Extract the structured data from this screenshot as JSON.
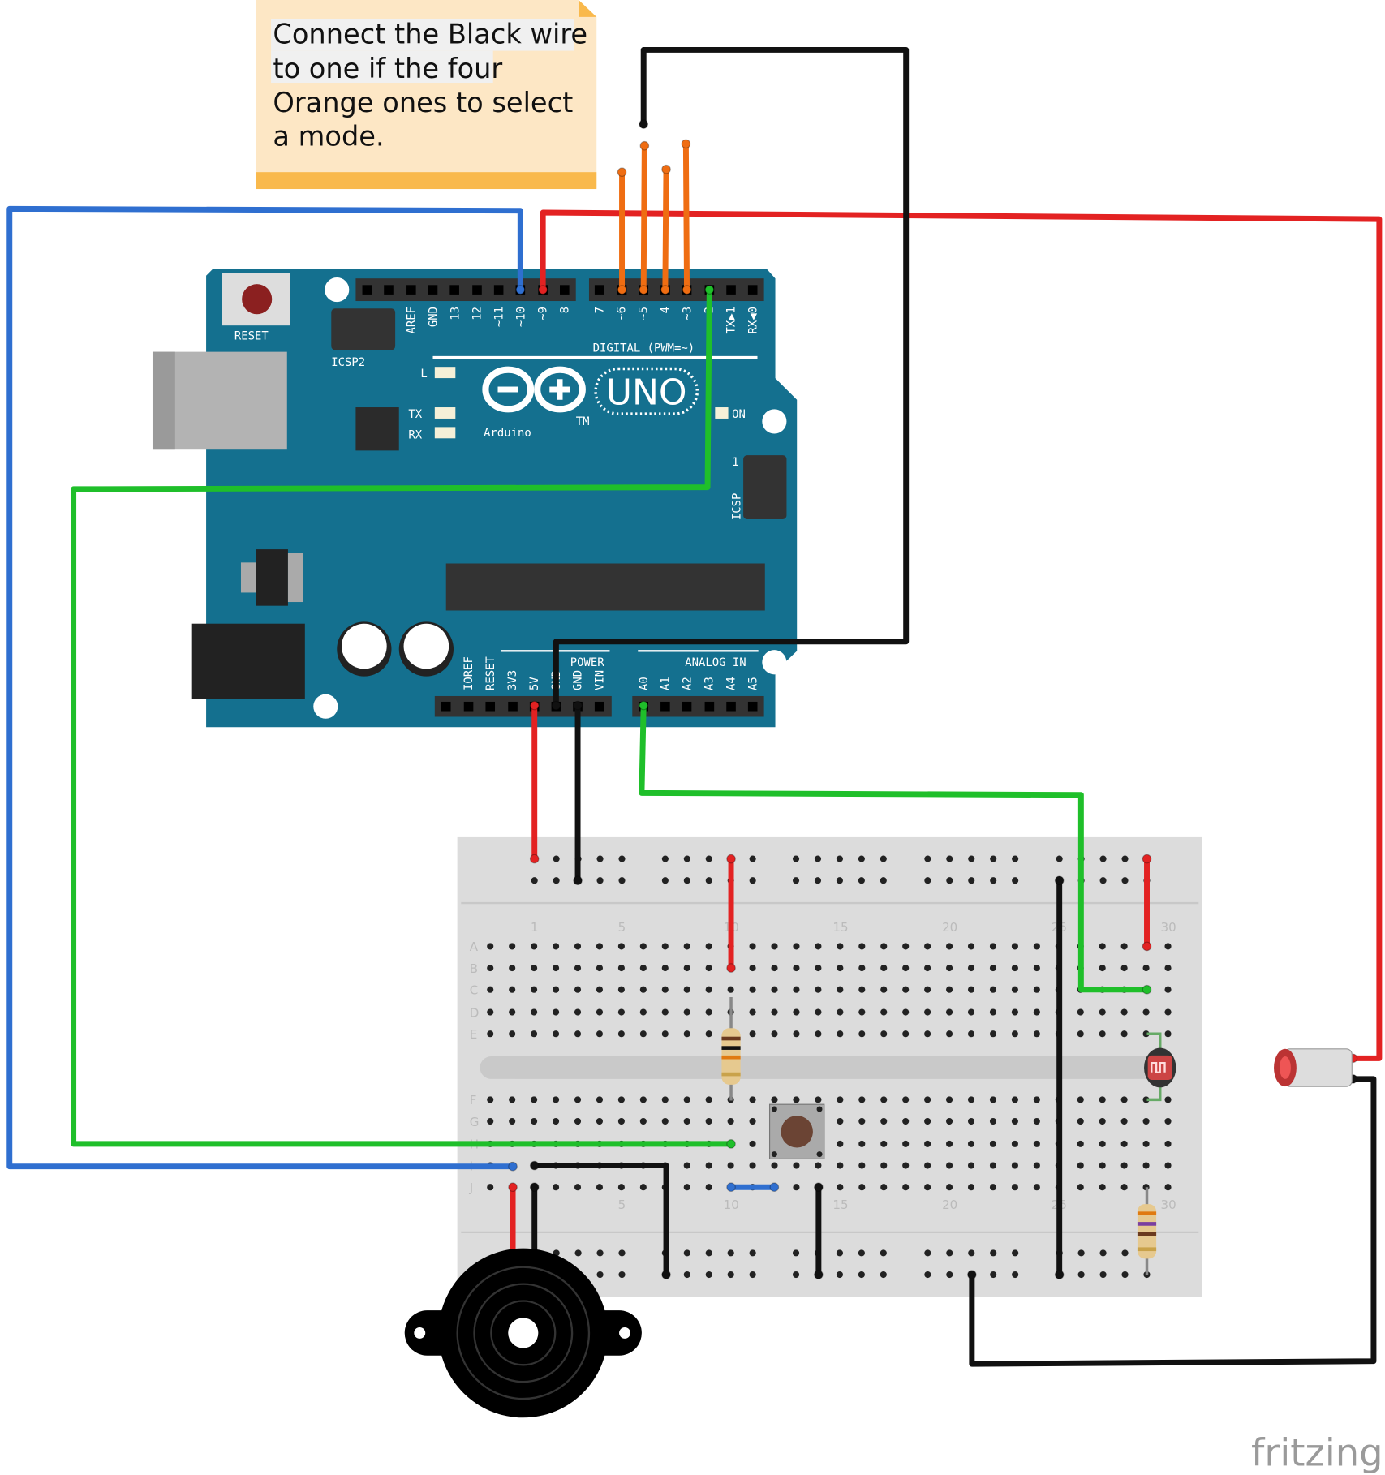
{
  "note": {
    "lines": [
      "Connect the Black wire",
      "to one if the four",
      "Orange ones to select",
      "a mode."
    ]
  },
  "arduino": {
    "reset_label": "RESET",
    "icsp2_label": "ICSP2",
    "icsp_label": "ICSP",
    "icsp_pin1": "1",
    "digital_label": "DIGITAL (PWM=~)",
    "power_label": "POWER",
    "analog_label": "ANALOG IN",
    "led_l": "L",
    "led_tx": "TX",
    "led_rx": "RX",
    "led_on": "ON",
    "model": "UNO",
    "brand": "Arduino",
    "tm": "TM",
    "top_left_pins": [
      "AREF",
      "GND",
      "13",
      "12",
      "~11",
      "~10",
      "~9",
      "8"
    ],
    "top_right_pins": [
      "7",
      "~6",
      "~5",
      "4",
      "~3",
      "2",
      "TX▶1",
      "RX◀0"
    ],
    "power_pins": [
      "IOREF",
      "RESET",
      "3V3",
      "5V",
      "GND",
      "GND",
      "VIN"
    ],
    "analog_pins": [
      "A0",
      "A1",
      "A2",
      "A3",
      "A4",
      "A5"
    ],
    "board_color": "#14708f"
  },
  "breadboard": {
    "rows_top": [
      "A",
      "B",
      "C",
      "D",
      "E"
    ],
    "rows_bottom": [
      "F",
      "G",
      "H",
      "I",
      "J"
    ],
    "column_labels": [
      "1",
      "5",
      "10",
      "15",
      "20",
      "25",
      "30"
    ]
  },
  "wire_colors": {
    "blue": "#2f6fd0",
    "red": "#e32222",
    "black": "#111111",
    "orange": "#ef6d12",
    "green": "#1fbf2a"
  },
  "watermark": "fritzing"
}
